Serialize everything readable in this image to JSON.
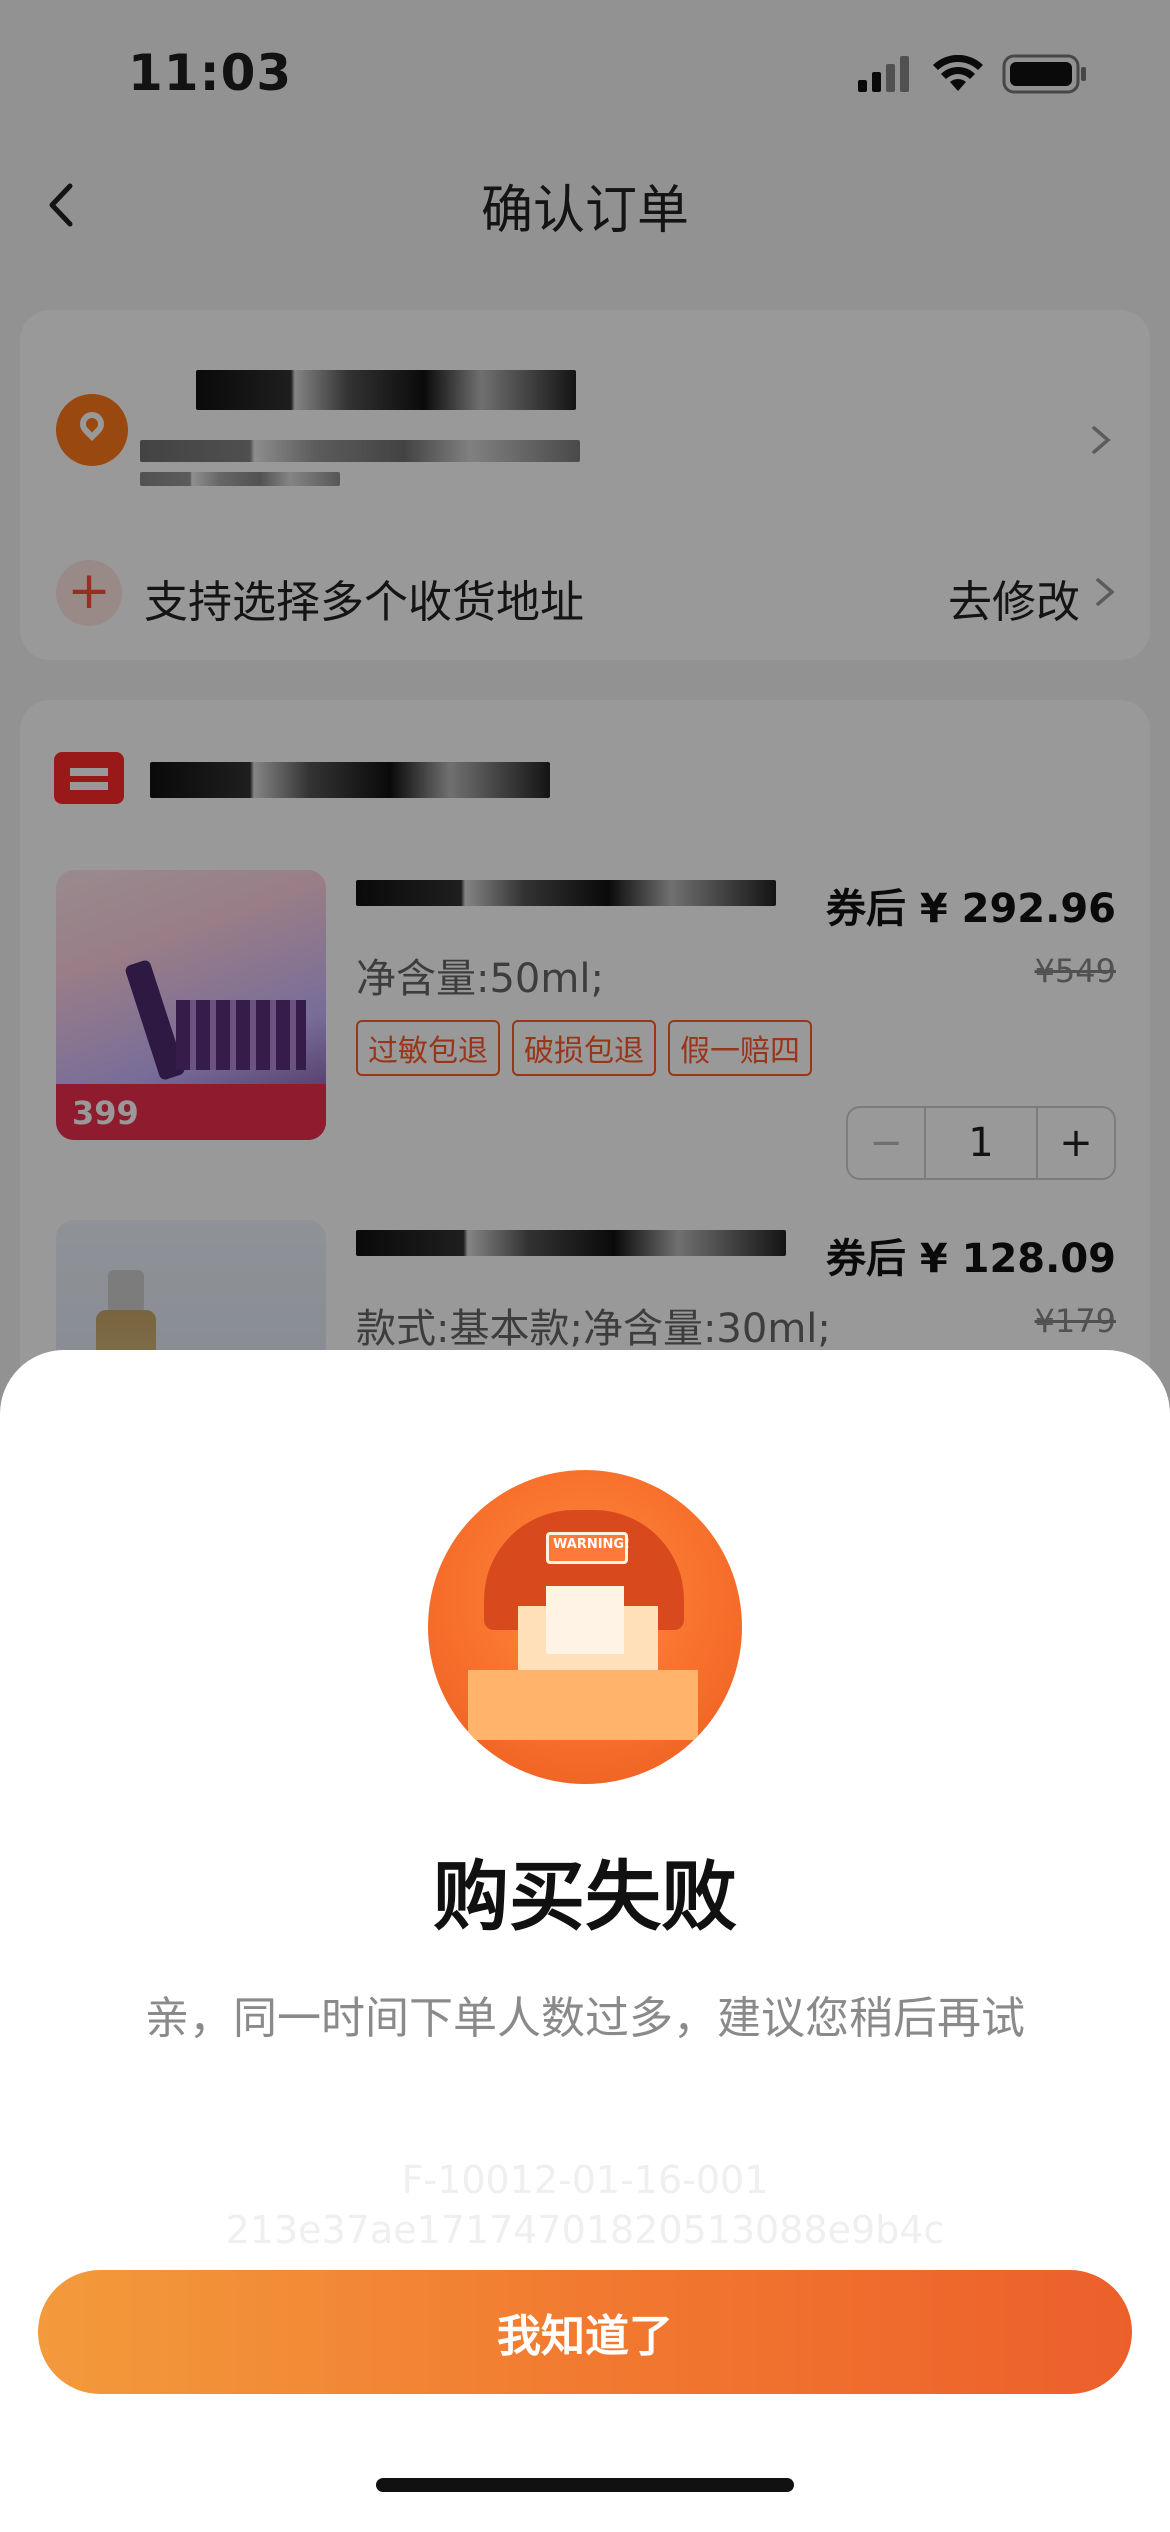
{
  "status_bar": {
    "time": "11:03"
  },
  "header": {
    "title": "确认订单"
  },
  "address": {
    "multi_address_label": "支持选择多个收货地址",
    "edit_label": "去修改"
  },
  "items": [
    {
      "coupon_price": "券后 ¥ 292.96",
      "spec": "净含量:50ml;",
      "original_price": "¥549",
      "tags": [
        "过敏包退",
        "破损包退",
        "假一赔四"
      ],
      "quantity": "1",
      "thumb_price": "399"
    },
    {
      "coupon_price": "券后 ¥ 128.09",
      "spec": "款式:基本款;净含量:30ml;",
      "original_price": "¥179"
    }
  ],
  "dialog": {
    "title": "购买失败",
    "message": "亲，同一时间下单人数过多，建议您稍后再试",
    "trace_line1": "F-10012-01-16-001",
    "trace_line2": "213e37ae17174701820513088e9b4c",
    "ok_button": "我知道了"
  },
  "colors": {
    "accent": "#f1772f",
    "tag": "#ff5a2a",
    "mask": "rgba(0,0,0,0.4)"
  }
}
